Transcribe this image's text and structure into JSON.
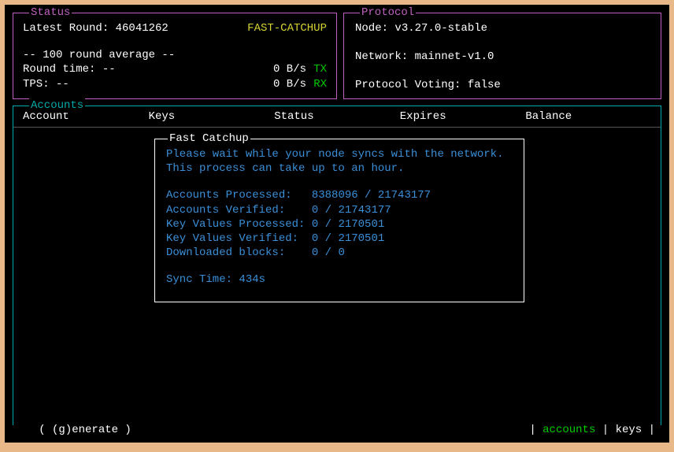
{
  "status": {
    "title": "Status",
    "latest_round_label": "Latest Round:",
    "latest_round_value": "46041262",
    "mode": "FAST-CATCHUP",
    "avg_header": "-- 100 round average --",
    "round_time_label": "Round time:",
    "round_time_value": "--",
    "bytes_value": "0 B/s",
    "tx_label": "TX",
    "tps_label": "TPS:",
    "tps_value": "--",
    "rx_label": "RX"
  },
  "protocol": {
    "title": "Protocol",
    "node_label": "Node:",
    "node_value": "v3.27.0-stable",
    "network_label": "Network:",
    "network_value": "mainnet-v1.0",
    "voting_label": "Protocol Voting:",
    "voting_value": "false"
  },
  "accounts": {
    "title": "Accounts",
    "columns": {
      "account": "Account",
      "keys": "Keys",
      "status": "Status",
      "expires": "Expires",
      "balance": "Balance"
    }
  },
  "catchup": {
    "title": "Fast Catchup",
    "msg1": "Please wait while your node syncs with the network.",
    "msg2": "This process can take up to an hour.",
    "accounts_processed_label": "Accounts Processed:  ",
    "accounts_processed_value": "8388096 / 21743177",
    "accounts_verified_label": "Accounts Verified:   ",
    "accounts_verified_value": "0 / 21743177",
    "kvp_label": "Key Values Processed:",
    "kvp_value": "0 / 2170501",
    "kvv_label": "Key Values Verified: ",
    "kvv_value": "0 / 2170501",
    "blocks_label": "Downloaded blocks:   ",
    "blocks_value": "0 / 0",
    "sync_label": "Sync Time:",
    "sync_value": "434s"
  },
  "footer": {
    "generate": "( (g)enerate )",
    "accounts": "accounts",
    "keys": "keys",
    "sep": " | "
  }
}
